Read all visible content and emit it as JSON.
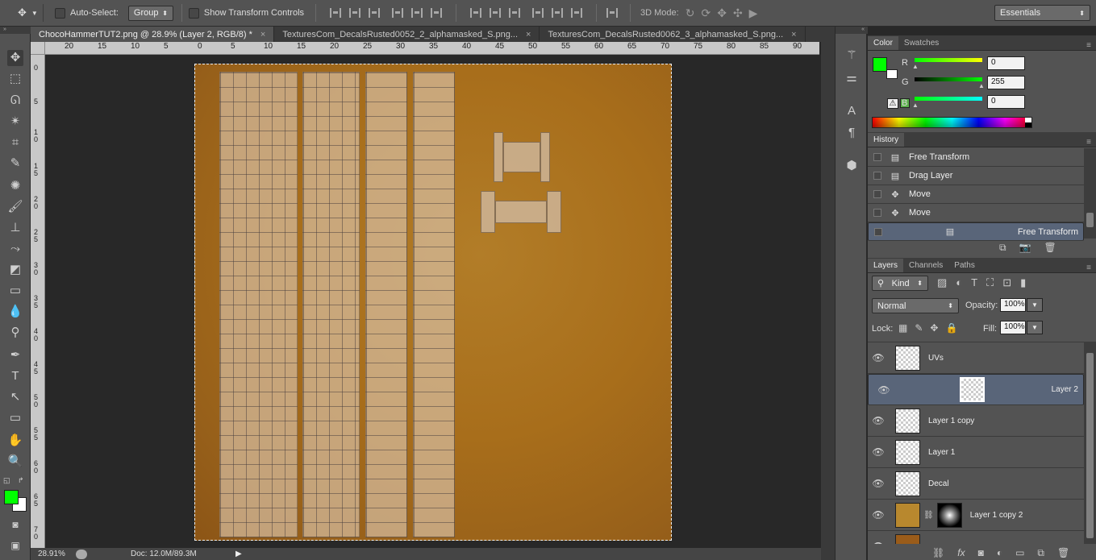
{
  "options_bar": {
    "auto_select_label": "Auto-Select:",
    "auto_select_value": "Group",
    "show_transform_label": "Show Transform Controls",
    "mode_3d_label": "3D Mode:",
    "workspace": "Essentials"
  },
  "tabs": [
    {
      "label": "ChocoHammerTUT2.png @ 28.9% (Layer 2, RGB/8) *",
      "active": true
    },
    {
      "label": "TexturesCom_DecalsRusted0052_2_alphamasked_S.png...",
      "active": false
    },
    {
      "label": "TexturesCom_DecalsRusted0062_3_alphamasked_S.png...",
      "active": false
    }
  ],
  "ruler_top": [
    "20",
    "15",
    "10",
    "5",
    "0",
    "5",
    "10",
    "15",
    "20",
    "25",
    "30",
    "35",
    "40",
    "45",
    "50",
    "55",
    "60",
    "65",
    "70",
    "75",
    "80",
    "85",
    "90"
  ],
  "ruler_left": [
    "0",
    "5",
    "1 0",
    "1 5",
    "2 0",
    "2 5",
    "3 0",
    "3 5",
    "4 0",
    "4 5",
    "5 0",
    "5 5",
    "6 0",
    "6 5",
    "7 0"
  ],
  "status": {
    "zoom": "28.91%",
    "doc": "Doc: 12.0M/89.3M"
  },
  "color_panel": {
    "tabs": [
      "Color",
      "Swatches"
    ],
    "r_label": "R",
    "r_value": "0",
    "g_label": "G",
    "g_value": "255",
    "b_label": "B",
    "b_value": "0",
    "foreground": "#00ff00",
    "background": "#ffffff",
    "slider_colors": {
      "r": "#e8e800",
      "g": "#00c800",
      "b": "#00d8d8"
    }
  },
  "history_panel": {
    "title": "History",
    "items": [
      "Free Transform",
      "Drag Layer",
      "Move",
      "Move",
      "Free Transform"
    ]
  },
  "layers_panel": {
    "tabs": [
      "Layers",
      "Channels",
      "Paths"
    ],
    "kind": "Kind",
    "blend_mode": "Normal",
    "opacity_label": "Opacity:",
    "opacity": "100%",
    "lock_label": "Lock:",
    "fill_label": "Fill:",
    "fill": "100%",
    "layers": [
      "UVs",
      "Layer 2",
      "Layer 1 copy",
      "Layer 1",
      "Decal",
      "Layer 1 copy 2"
    ],
    "selected": "Layer 2"
  }
}
